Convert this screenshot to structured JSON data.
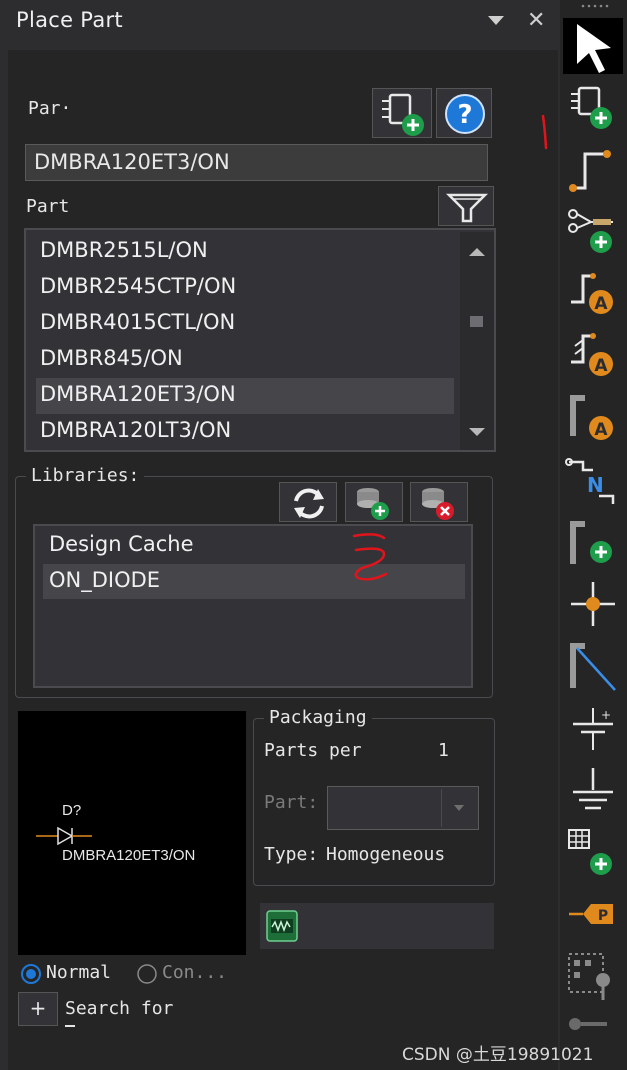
{
  "window": {
    "title": "Place Part"
  },
  "part_section": {
    "label": "Par·",
    "value": "DMBRA120ET3/ON",
    "list_label": "Part"
  },
  "part_list": {
    "items": [
      "DMBR2515L/ON",
      "DMBR2545CTP/ON",
      "DMBR4015CTL/ON",
      "DMBR845/ON",
      "DMBRA120ET3/ON",
      "DMBRA120LT3/ON"
    ],
    "selected": "DMBRA120ET3/ON"
  },
  "libraries": {
    "label": "Libraries:",
    "items": [
      "Design Cache",
      "ON_DIODE"
    ],
    "selected": "ON_DIODE"
  },
  "preview": {
    "refdes": "D?",
    "part_name": "DMBRA120ET3/ON"
  },
  "packaging": {
    "title": "Packaging",
    "parts_per_label": "Parts per",
    "parts_per_value": "1",
    "part_label": "Part:",
    "type_label": "Type:",
    "type_value": "Homogeneous"
  },
  "view_mode": {
    "normal": "Normal",
    "convert": "Con...",
    "selected": "normal"
  },
  "search": {
    "expand": "+",
    "label": "Search for"
  },
  "annotations": {
    "mark1": "1",
    "mark2": "2"
  },
  "watermark": "CSDN @土豆19891021",
  "colors": {
    "accent_green": "#1e9e4a",
    "help_blue": "#1e78d7",
    "pin_orange": "#e08a1e",
    "annotation_red": "#e0151b"
  },
  "toolbar_icons": [
    "select-arrow-icon",
    "place-part-icon",
    "place-wire-icon",
    "place-net-group-icon",
    "place-net-alias-icon",
    "place-bus-alias-icon",
    "place-port-alias-icon",
    "place-net-name-icon",
    "place-bus-icon",
    "place-junction-icon",
    "place-bus-entry-icon",
    "place-power-icon",
    "place-ground-icon",
    "place-off-page-icon",
    "place-no-connect-icon",
    "place-block-icon",
    "place-pin-icon"
  ]
}
